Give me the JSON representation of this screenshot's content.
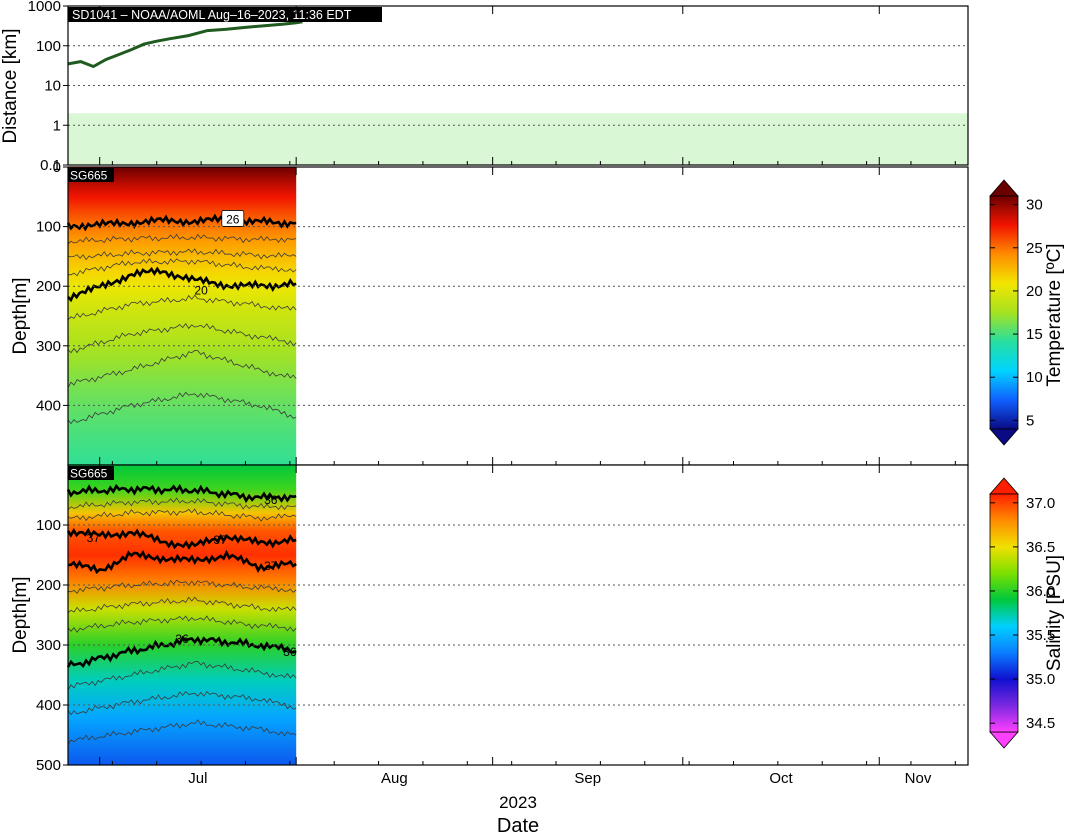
{
  "header": {
    "label": "SD1041   –   NOAA/AOML   Aug–16–2023, 11:36 EDT"
  },
  "colors": {
    "track": "#1f5a1f",
    "band": "#d9f7d4",
    "contour_minor": "#3a3a3a",
    "contour_major": "#000000"
  },
  "chart_data": [
    {
      "id": "distance",
      "type": "line",
      "ylabel": "Distance [km]",
      "y_scale": "log",
      "ylim": [
        0.1,
        1000
      ],
      "y_ticks": [
        "0.1",
        "1",
        "10",
        "100",
        "1000"
      ],
      "band": [
        0.1,
        2
      ],
      "grid": true,
      "series": [
        {
          "x": [
            "2023-06-26",
            "2023-06-28",
            "2023-06-30",
            "2023-07-02",
            "2023-07-04",
            "2023-07-06",
            "2023-07-08",
            "2023-07-10",
            "2023-07-12",
            "2023-07-15",
            "2023-07-18",
            "2023-07-21",
            "2023-07-24",
            "2023-07-27",
            "2023-07-30",
            "2023-08-01",
            "2023-08-02"
          ],
          "y": [
            35,
            40,
            30,
            45,
            60,
            80,
            110,
            130,
            150,
            180,
            240,
            260,
            290,
            320,
            350,
            380,
            400
          ]
        }
      ]
    },
    {
      "id": "temperature",
      "type": "heatmap",
      "panel_label": "SG665",
      "ylabel": "Depth[m]",
      "ylim": [
        0,
        500
      ],
      "y_ticks": [
        "0",
        "100",
        "200",
        "300",
        "400"
      ],
      "y_inverted": true,
      "grid": true,
      "colorbar": {
        "label": "Temperature [ºC]",
        "min": 4,
        "max": 31,
        "ticks": [
          "5",
          "10",
          "15",
          "20",
          "25",
          "30"
        ],
        "stops": [
          "#0a0a85",
          "#1060ff",
          "#00d5ff",
          "#26dfa0",
          "#a6e220",
          "#f3e600",
          "#ff8c00",
          "#f21400",
          "#6b0000"
        ]
      },
      "surface_value": 31,
      "deep_value": 11.5,
      "contour_labels": [
        {
          "text": "26",
          "x": "2023-07-22",
          "depth": 88,
          "boxed": true
        },
        {
          "text": "20",
          "x": "2023-07-17",
          "depth": 207,
          "boxed": false
        }
      ],
      "major_contours": [
        {
          "value": 26,
          "x": [
            "2023-06-26",
            "2023-07-01",
            "2023-07-06",
            "2023-07-11",
            "2023-07-16",
            "2023-07-21",
            "2023-07-26",
            "2023-08-01"
          ],
          "depth": [
            98,
            97,
            93,
            90,
            91,
            88,
            92,
            94
          ]
        },
        {
          "value": 20,
          "x": [
            "2023-06-26",
            "2023-07-01",
            "2023-07-06",
            "2023-07-11",
            "2023-07-16",
            "2023-07-21",
            "2023-07-26",
            "2023-08-01"
          ],
          "depth": [
            218,
            202,
            180,
            175,
            190,
            198,
            200,
            196
          ]
        }
      ],
      "minor_contours": [
        {
          "x": [
            "2023-06-26",
            "2023-07-06",
            "2023-07-16",
            "2023-07-26",
            "2023-08-01"
          ],
          "depth": [
            125,
            120,
            118,
            122,
            120
          ]
        },
        {
          "x": [
            "2023-06-26",
            "2023-07-06",
            "2023-07-16",
            "2023-07-26",
            "2023-08-01"
          ],
          "depth": [
            152,
            145,
            142,
            148,
            150
          ]
        },
        {
          "x": [
            "2023-06-26",
            "2023-07-06",
            "2023-07-16",
            "2023-07-26",
            "2023-08-01"
          ],
          "depth": [
            180,
            160,
            158,
            170,
            172
          ]
        },
        {
          "x": [
            "2023-06-26",
            "2023-07-06",
            "2023-07-16",
            "2023-07-26",
            "2023-08-01"
          ],
          "depth": [
            255,
            230,
            220,
            232,
            240
          ]
        },
        {
          "x": [
            "2023-06-26",
            "2023-07-06",
            "2023-07-16",
            "2023-07-26",
            "2023-08-01"
          ],
          "depth": [
            310,
            280,
            265,
            285,
            295
          ]
        },
        {
          "x": [
            "2023-06-26",
            "2023-07-06",
            "2023-07-16",
            "2023-07-26",
            "2023-08-01"
          ],
          "depth": [
            365,
            340,
            310,
            340,
            355
          ]
        },
        {
          "x": [
            "2023-06-26",
            "2023-07-06",
            "2023-07-16",
            "2023-07-26",
            "2023-08-01"
          ],
          "depth": [
            430,
            400,
            380,
            400,
            420
          ]
        }
      ]
    },
    {
      "id": "salinity",
      "type": "heatmap",
      "panel_label": "SG665",
      "ylabel": "Depth[m]",
      "ylim": [
        0,
        500
      ],
      "y_ticks": [
        "100",
        "200",
        "300",
        "400",
        "500"
      ],
      "y_inverted": true,
      "grid": true,
      "colorbar": {
        "label": "Salinity [PSU]",
        "min": 34.4,
        "max": 37.1,
        "ticks": [
          "34.5",
          "35.0",
          "35.5",
          "36.0",
          "36.5",
          "37.0"
        ],
        "stops": [
          "#ff40ff",
          "#7a28e0",
          "#1010d0",
          "#0a7dff",
          "#00d0ff",
          "#00c83c",
          "#7de000",
          "#f0e000",
          "#ff8c00",
          "#ff1e00"
        ]
      },
      "profile": [
        {
          "depth": 0,
          "value": 35.9
        },
        {
          "depth": 40,
          "value": 36.05
        },
        {
          "depth": 80,
          "value": 36.6
        },
        {
          "depth": 110,
          "value": 36.95
        },
        {
          "depth": 150,
          "value": 37.05
        },
        {
          "depth": 190,
          "value": 36.85
        },
        {
          "depth": 240,
          "value": 36.4
        },
        {
          "depth": 300,
          "value": 36.0
        },
        {
          "depth": 360,
          "value": 35.7
        },
        {
          "depth": 420,
          "value": 35.45
        },
        {
          "depth": 500,
          "value": 35.2
        }
      ],
      "contour_labels": [
        {
          "text": "37",
          "x": "2023-06-30",
          "depth": 122,
          "boxed": false
        },
        {
          "text": "37",
          "x": "2023-07-20",
          "depth": 125,
          "boxed": false
        },
        {
          "text": "37",
          "x": "2023-07-28",
          "depth": 168,
          "boxed": false
        },
        {
          "text": "36",
          "x": "2023-07-28",
          "depth": 58,
          "boxed": false
        },
        {
          "text": "36",
          "x": "2023-07-14",
          "depth": 290,
          "boxed": false
        },
        {
          "text": "36",
          "x": "2023-07-31",
          "depth": 312,
          "boxed": false
        }
      ],
      "major_contours": [
        {
          "value": 36,
          "x": [
            "2023-06-26",
            "2023-07-06",
            "2023-07-16",
            "2023-07-26",
            "2023-08-01"
          ],
          "depth": [
            45,
            40,
            42,
            55,
            52
          ]
        },
        {
          "value": 37,
          "x": [
            "2023-06-26",
            "2023-07-01",
            "2023-07-06",
            "2023-07-11",
            "2023-07-16",
            "2023-07-21",
            "2023-07-26",
            "2023-08-01"
          ],
          "depth": [
            110,
            118,
            112,
            128,
            135,
            118,
            130,
            125
          ]
        },
        {
          "value": 37,
          "x": [
            "2023-06-26",
            "2023-07-01",
            "2023-07-06",
            "2023-07-11",
            "2023-07-16",
            "2023-07-21",
            "2023-07-26",
            "2023-08-01"
          ],
          "depth": [
            165,
            175,
            150,
            155,
            160,
            150,
            170,
            165
          ]
        },
        {
          "value": 36,
          "x": [
            "2023-06-26",
            "2023-07-06",
            "2023-07-16",
            "2023-07-26",
            "2023-08-01"
          ],
          "depth": [
            335,
            310,
            290,
            300,
            310
          ]
        }
      ],
      "minor_contours": [
        {
          "x": [
            "2023-06-26",
            "2023-07-06",
            "2023-07-16",
            "2023-07-26",
            "2023-08-01"
          ],
          "depth": [
            70,
            62,
            60,
            70,
            68
          ]
        },
        {
          "x": [
            "2023-06-26",
            "2023-07-06",
            "2023-07-16",
            "2023-07-26",
            "2023-08-01"
          ],
          "depth": [
            90,
            80,
            78,
            88,
            86
          ]
        },
        {
          "x": [
            "2023-06-26",
            "2023-07-06",
            "2023-07-16",
            "2023-07-26",
            "2023-08-01"
          ],
          "depth": [
            210,
            200,
            195,
            205,
            208
          ]
        },
        {
          "x": [
            "2023-06-26",
            "2023-07-06",
            "2023-07-16",
            "2023-07-26",
            "2023-08-01"
          ],
          "depth": [
            245,
            232,
            225,
            238,
            242
          ]
        },
        {
          "x": [
            "2023-06-26",
            "2023-07-06",
            "2023-07-16",
            "2023-07-26",
            "2023-08-01"
          ],
          "depth": [
            275,
            262,
            255,
            268,
            272
          ]
        },
        {
          "x": [
            "2023-06-26",
            "2023-07-06",
            "2023-07-16",
            "2023-07-26",
            "2023-08-01"
          ],
          "depth": [
            370,
            350,
            330,
            345,
            355
          ]
        },
        {
          "x": [
            "2023-06-26",
            "2023-07-06",
            "2023-07-16",
            "2023-07-26",
            "2023-08-01"
          ],
          "depth": [
            415,
            395,
            380,
            390,
            405
          ]
        },
        {
          "x": [
            "2023-06-26",
            "2023-07-06",
            "2023-07-16",
            "2023-07-26",
            "2023-08-01"
          ],
          "depth": [
            460,
            445,
            430,
            440,
            450
          ]
        }
      ]
    }
  ],
  "x_axis": {
    "range": [
      "2023-06-26",
      "2023-11-15"
    ],
    "ticks": [
      {
        "label": "Jul",
        "date": "2023-07-01"
      },
      {
        "label": "Aug",
        "date": "2023-08-01"
      },
      {
        "label": "Sep",
        "date": "2023-09-01"
      },
      {
        "label": "Oct",
        "date": "2023-10-01"
      },
      {
        "label": "Nov",
        "date": "2023-11-01"
      }
    ],
    "year_label": "2023",
    "title": "Date",
    "data_end": "2023-08-01"
  }
}
